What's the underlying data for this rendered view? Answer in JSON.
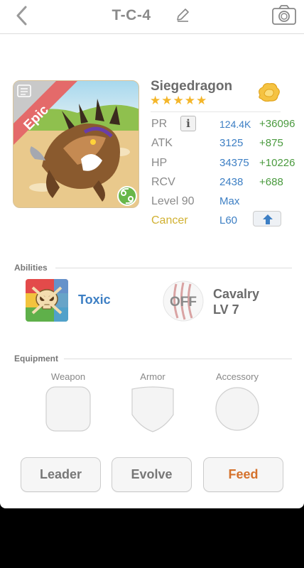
{
  "header": {
    "title": "T-C-4"
  },
  "monster": {
    "rarity": "Epic",
    "name": "Siegedragon",
    "stars": "★★★★★",
    "star_count": 5
  },
  "stats": {
    "pr": {
      "label": "PR",
      "value": "124.4K",
      "bonus": "+36096"
    },
    "atk": {
      "label": "ATK",
      "value": "3125",
      "bonus": "+875"
    },
    "hp": {
      "label": "HP",
      "value": "34375",
      "bonus": "+10226"
    },
    "rcv": {
      "label": "RCV",
      "value": "2438",
      "bonus": "+688"
    },
    "level": {
      "label": "Level 90",
      "value": "Max"
    },
    "sign": {
      "label": "Cancer",
      "value": "L60"
    },
    "info_glyph": "i"
  },
  "abilities": {
    "section_title": "Abilities",
    "ability_name": "Toxic",
    "leader_status": "OFF",
    "leader_name": "Cavalry",
    "leader_level": "LV 7"
  },
  "equipment": {
    "section_title": "Equipment",
    "weapon": "Weapon",
    "armor": "Armor",
    "accessory": "Accessory"
  },
  "actions": {
    "leader": "Leader",
    "evolve": "Evolve",
    "feed": "Feed"
  },
  "colors": {
    "value_blue": "#3d7fc4",
    "bonus_green": "#4a9a3e",
    "sign_gold": "#d1b132",
    "feed_orange": "#d5722c",
    "star_gold": "#f4b62a",
    "epic_red": "#e46a6a"
  },
  "icons": {
    "back": "chevron-left-icon",
    "edit": "pencil-icon",
    "camera": "camera-icon",
    "orb": "gold-orb-icon",
    "zodiac": "cancer-zodiac-icon",
    "upgrade": "arrow-up-icon",
    "ability": "skull-icon",
    "leader": "claw-mark-icon"
  }
}
